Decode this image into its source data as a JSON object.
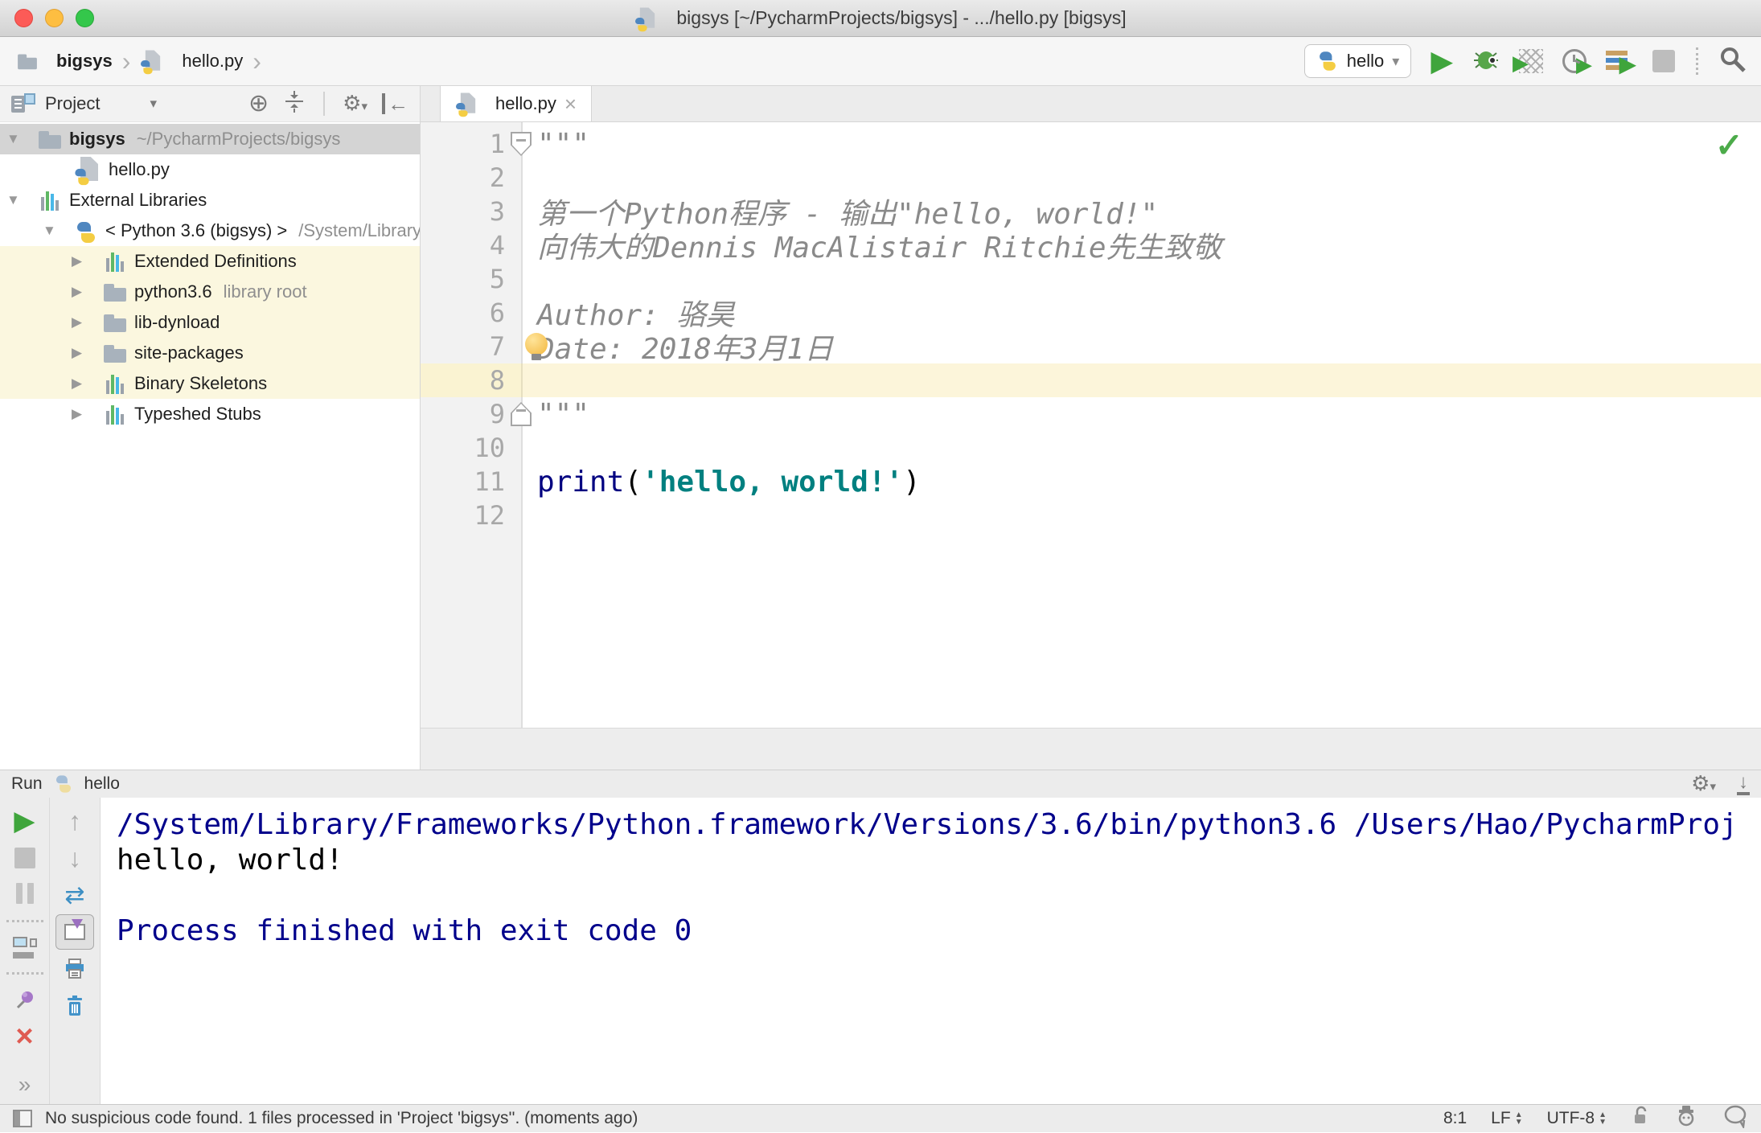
{
  "window": {
    "title": "bigsys [~/PycharmProjects/bigsys] - .../hello.py [bigsys]"
  },
  "breadcrumb": {
    "project": "bigsys",
    "file": "hello.py"
  },
  "toolbar": {
    "run_config": "hello"
  },
  "project_panel": {
    "title": "Project",
    "tree": [
      {
        "indent": 8,
        "arrow": "down",
        "icon": "folder",
        "label": "bigsys",
        "suffix": "~/PycharmProjects/bigsys",
        "bold": true,
        "bg": "selected"
      },
      {
        "indent": 95,
        "arrow": "none",
        "icon": "pyfile",
        "label": "hello.py",
        "suffix": "",
        "bg": "none"
      },
      {
        "indent": 8,
        "arrow": "down",
        "icon": "lib",
        "label": "External Libraries",
        "suffix": "",
        "bg": "none"
      },
      {
        "indent": 53,
        "arrow": "down",
        "icon": "python",
        "label": "< Python 3.6 (bigsys) >",
        "suffix": "/System/Library/Frameworks",
        "bg": "none"
      },
      {
        "indent": 89,
        "arrow": "right",
        "icon": "lib",
        "label": "Extended Definitions",
        "suffix": "",
        "bg": "yellow"
      },
      {
        "indent": 89,
        "arrow": "right",
        "icon": "folder",
        "label": "python3.6",
        "suffix": "library root",
        "bg": "yellow"
      },
      {
        "indent": 89,
        "arrow": "right",
        "icon": "folder",
        "label": "lib-dynload",
        "suffix": "",
        "bg": "yellow"
      },
      {
        "indent": 89,
        "arrow": "right",
        "icon": "folder",
        "label": "site-packages",
        "suffix": "",
        "bg": "yellow"
      },
      {
        "indent": 89,
        "arrow": "right",
        "icon": "lib",
        "label": "Binary Skeletons",
        "suffix": "",
        "bg": "yellow"
      },
      {
        "indent": 89,
        "arrow": "right",
        "icon": "lib",
        "label": "Typeshed Stubs",
        "suffix": "",
        "bg": "none"
      }
    ]
  },
  "editor": {
    "tab": "hello.py",
    "lines": [
      {
        "num": "1",
        "fold": "start",
        "tokens": [
          {
            "t": "\"\"\"",
            "c": "doc"
          }
        ]
      },
      {
        "num": "2",
        "tokens": []
      },
      {
        "num": "3",
        "tokens": [
          {
            "t": "第一个Python程序 - 输出\"hello, world!\"",
            "c": "doc"
          }
        ]
      },
      {
        "num": "4",
        "tokens": [
          {
            "t": "向伟大的Dennis MacAlistair Ritchie先生致敬",
            "c": "doc"
          }
        ]
      },
      {
        "num": "5",
        "tokens": []
      },
      {
        "num": "6",
        "tokens": [
          {
            "t": "Author: 骆昊",
            "c": "doc"
          }
        ]
      },
      {
        "num": "7",
        "bulb": true,
        "tokens": [
          {
            "t": "Date: 2018年3月1日",
            "c": "doc"
          }
        ]
      },
      {
        "num": "8",
        "current": true,
        "tokens": []
      },
      {
        "num": "9",
        "fold": "end",
        "tokens": [
          {
            "t": "\"\"\"",
            "c": "doc"
          }
        ]
      },
      {
        "num": "10",
        "tokens": []
      },
      {
        "num": "11",
        "tokens": [
          {
            "t": "print",
            "c": "kw"
          },
          {
            "t": "(",
            "c": "plain"
          },
          {
            "t": "'hello, world!'",
            "c": "str"
          },
          {
            "t": ")",
            "c": "plain"
          }
        ]
      },
      {
        "num": "12",
        "tokens": []
      }
    ]
  },
  "run_panel": {
    "label": "Run",
    "tab": "hello",
    "console": [
      {
        "t": "/System/Library/Frameworks/Python.framework/Versions/3.6/bin/python3.6 /Users/Hao/PycharmProj",
        "c": "sys"
      },
      {
        "t": "hello, world!",
        "c": "out"
      },
      {
        "t": "",
        "c": "out"
      },
      {
        "t": "Process finished with exit code 0",
        "c": "sys"
      }
    ]
  },
  "status_bar": {
    "message": "No suspicious code found. 1 files processed in 'Project 'bigsys''. (moments ago)",
    "position": "8:1",
    "line_ending": "LF",
    "encoding": "UTF-8"
  },
  "icons": {
    "expanded": "▼",
    "collapsed": "▶",
    "chevron": "›",
    "combo_arrow": "▾",
    "run": "▶",
    "target": "⊕",
    "gear": "⚙",
    "arrow_left": "←",
    "arrow_down": "↓",
    "arrow_up": "↑",
    "close": "×",
    "more": "»",
    "soft_wrap": "⇄",
    "check": "✓",
    "tri_up": "▲",
    "tri_down": "▼"
  },
  "colors": {
    "run_green": "#3fa53c",
    "keyword": "#000080",
    "string": "#008080",
    "docstring": "#8a8a8a",
    "console_system": "#00008b",
    "current_line": "#fcf5da",
    "tree_highlight": "#fbf7df",
    "tree_selected": "#d4d4d4"
  }
}
